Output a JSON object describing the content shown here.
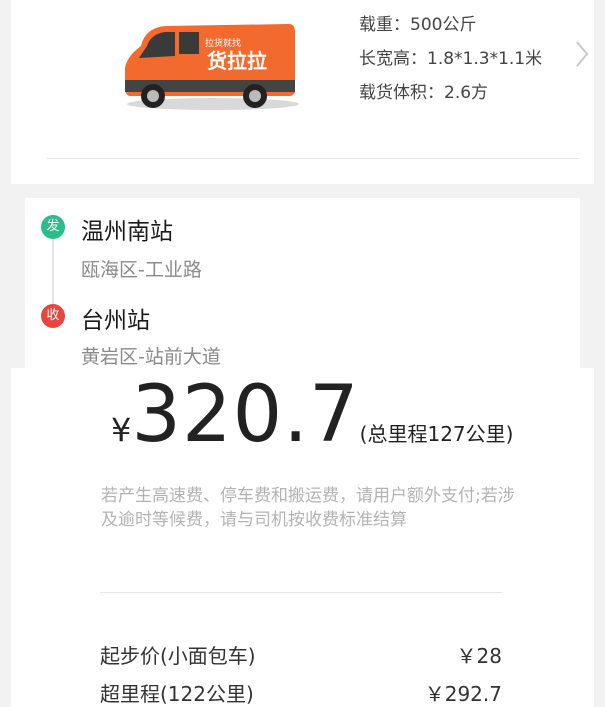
{
  "vehicle": {
    "image_text": "货拉拉",
    "image_slogan": "拉货就找",
    "specs": {
      "load": "载重：500公斤",
      "dimensions": "长宽高：1.8*1.3*1.1米",
      "volume": "载货体积：2.6方"
    },
    "icon": "chevron-right-icon",
    "body_color": "#f26a2e"
  },
  "route": {
    "origin": {
      "badge": "发",
      "name": "温州南站",
      "address": "瓯海区-工业路",
      "badge_color": "#2bbd8a"
    },
    "destination": {
      "badge": "收",
      "name": "台州站",
      "address": "黄岩区-站前大道",
      "badge_color": "#e8453c"
    }
  },
  "pricing": {
    "currency": "¥",
    "total": "320.7",
    "distance": "(总里程127公里)",
    "note": "若产生高速费、停车费和搬运费，请用户额外支付;若涉及逾时等候费，请与司机按收费标准结算",
    "items": [
      {
        "label": "起步价(小面包车)",
        "value": "￥28"
      },
      {
        "label": "超里程(122公里)",
        "value": "￥292.7"
      }
    ]
  }
}
